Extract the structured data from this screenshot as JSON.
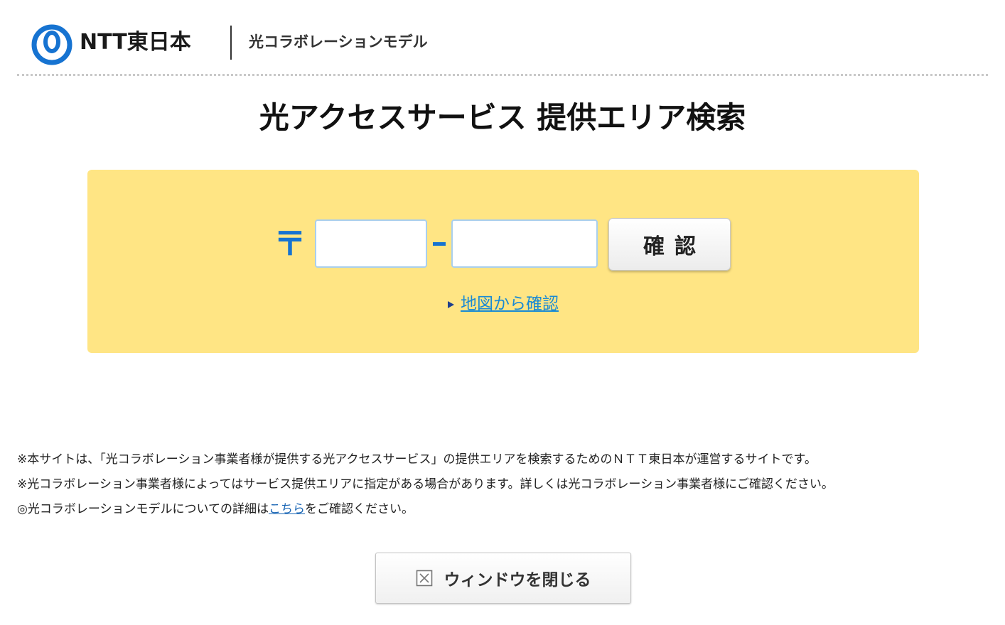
{
  "header": {
    "logo_text": "NTT東日本",
    "subtitle": "光コラボレーションモデル"
  },
  "colors": {
    "brand_blue": "#1673d1",
    "panel_yellow": "#ffe584",
    "link_blue": "#1a8ad4"
  },
  "title": "光アクセスサービス 提供エリア検索",
  "search": {
    "postal_mark": "〒",
    "zip_first_value": "",
    "zip_second_value": "",
    "confirm_label": "確認",
    "map_link_label": "地図から確認"
  },
  "notes": {
    "line1": "※本サイトは、「光コラボレーション事業者様が提供する光アクセスサービス」の提供エリアを検索するためのＮＴＴ東日本が運営するサイトです。",
    "line2": "※光コラボレーション事業者様によってはサービス提供エリアに指定がある場合があります。詳しくは光コラボレーション事業者様にご確認ください。",
    "line3_before": "◎光コラボレーションモデルについての詳細は",
    "line3_link": "こちら",
    "line3_after": "をご確認ください。"
  },
  "close_button": {
    "label": "ウィンドウを閉じる",
    "icon": "close-box-icon"
  }
}
